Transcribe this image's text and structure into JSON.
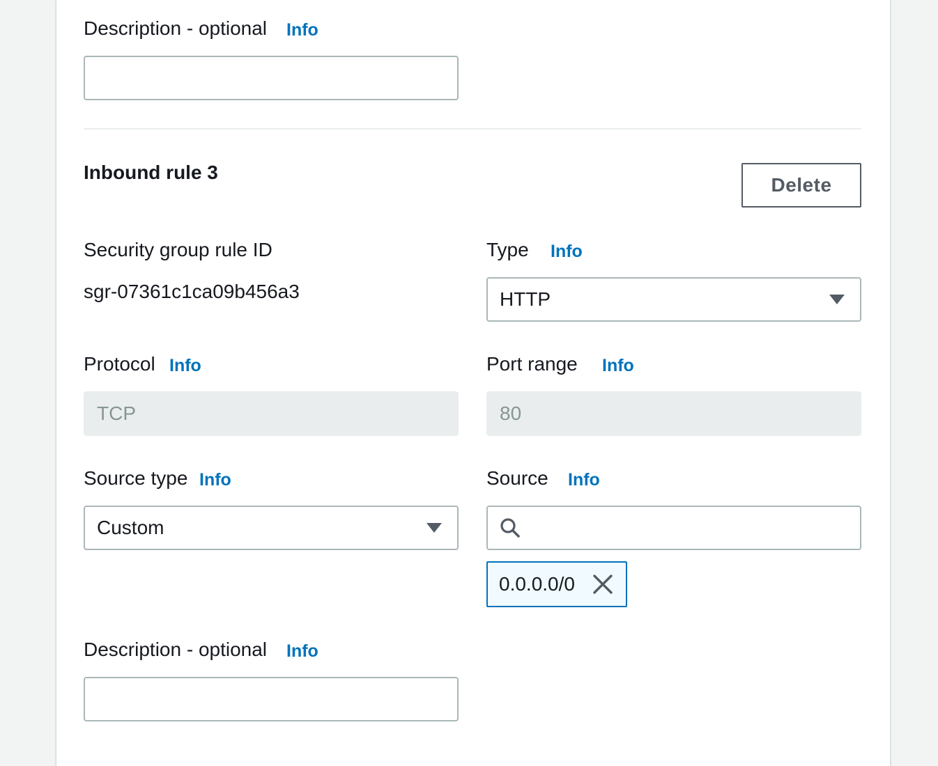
{
  "top_description": {
    "label": "Description - optional",
    "info": "Info",
    "value": ""
  },
  "rule": {
    "heading": "Inbound rule 3",
    "delete_label": "Delete",
    "rule_id_label": "Security group rule ID",
    "rule_id_value": "sgr-07361c1ca09b456a3",
    "type": {
      "label": "Type",
      "info": "Info",
      "value": "HTTP"
    },
    "protocol": {
      "label": "Protocol",
      "info": "Info",
      "value": "TCP"
    },
    "port_range": {
      "label": "Port range",
      "info": "Info",
      "value": "80"
    },
    "source_type": {
      "label": "Source type",
      "info": "Info",
      "value": "Custom"
    },
    "source": {
      "label": "Source",
      "info": "Info",
      "search_value": "",
      "tokens": [
        "0.0.0.0/0"
      ]
    },
    "description": {
      "label": "Description - optional",
      "info": "Info",
      "value": ""
    }
  },
  "colors": {
    "link": "#0073bb",
    "text": "#16191f",
    "border": "#aab7b8",
    "disabled_bg": "#eaeded",
    "token_bg": "#f1faff"
  },
  "icons": {
    "dropdown": "caret-down-icon",
    "search": "search-icon",
    "dismiss": "close-icon"
  }
}
